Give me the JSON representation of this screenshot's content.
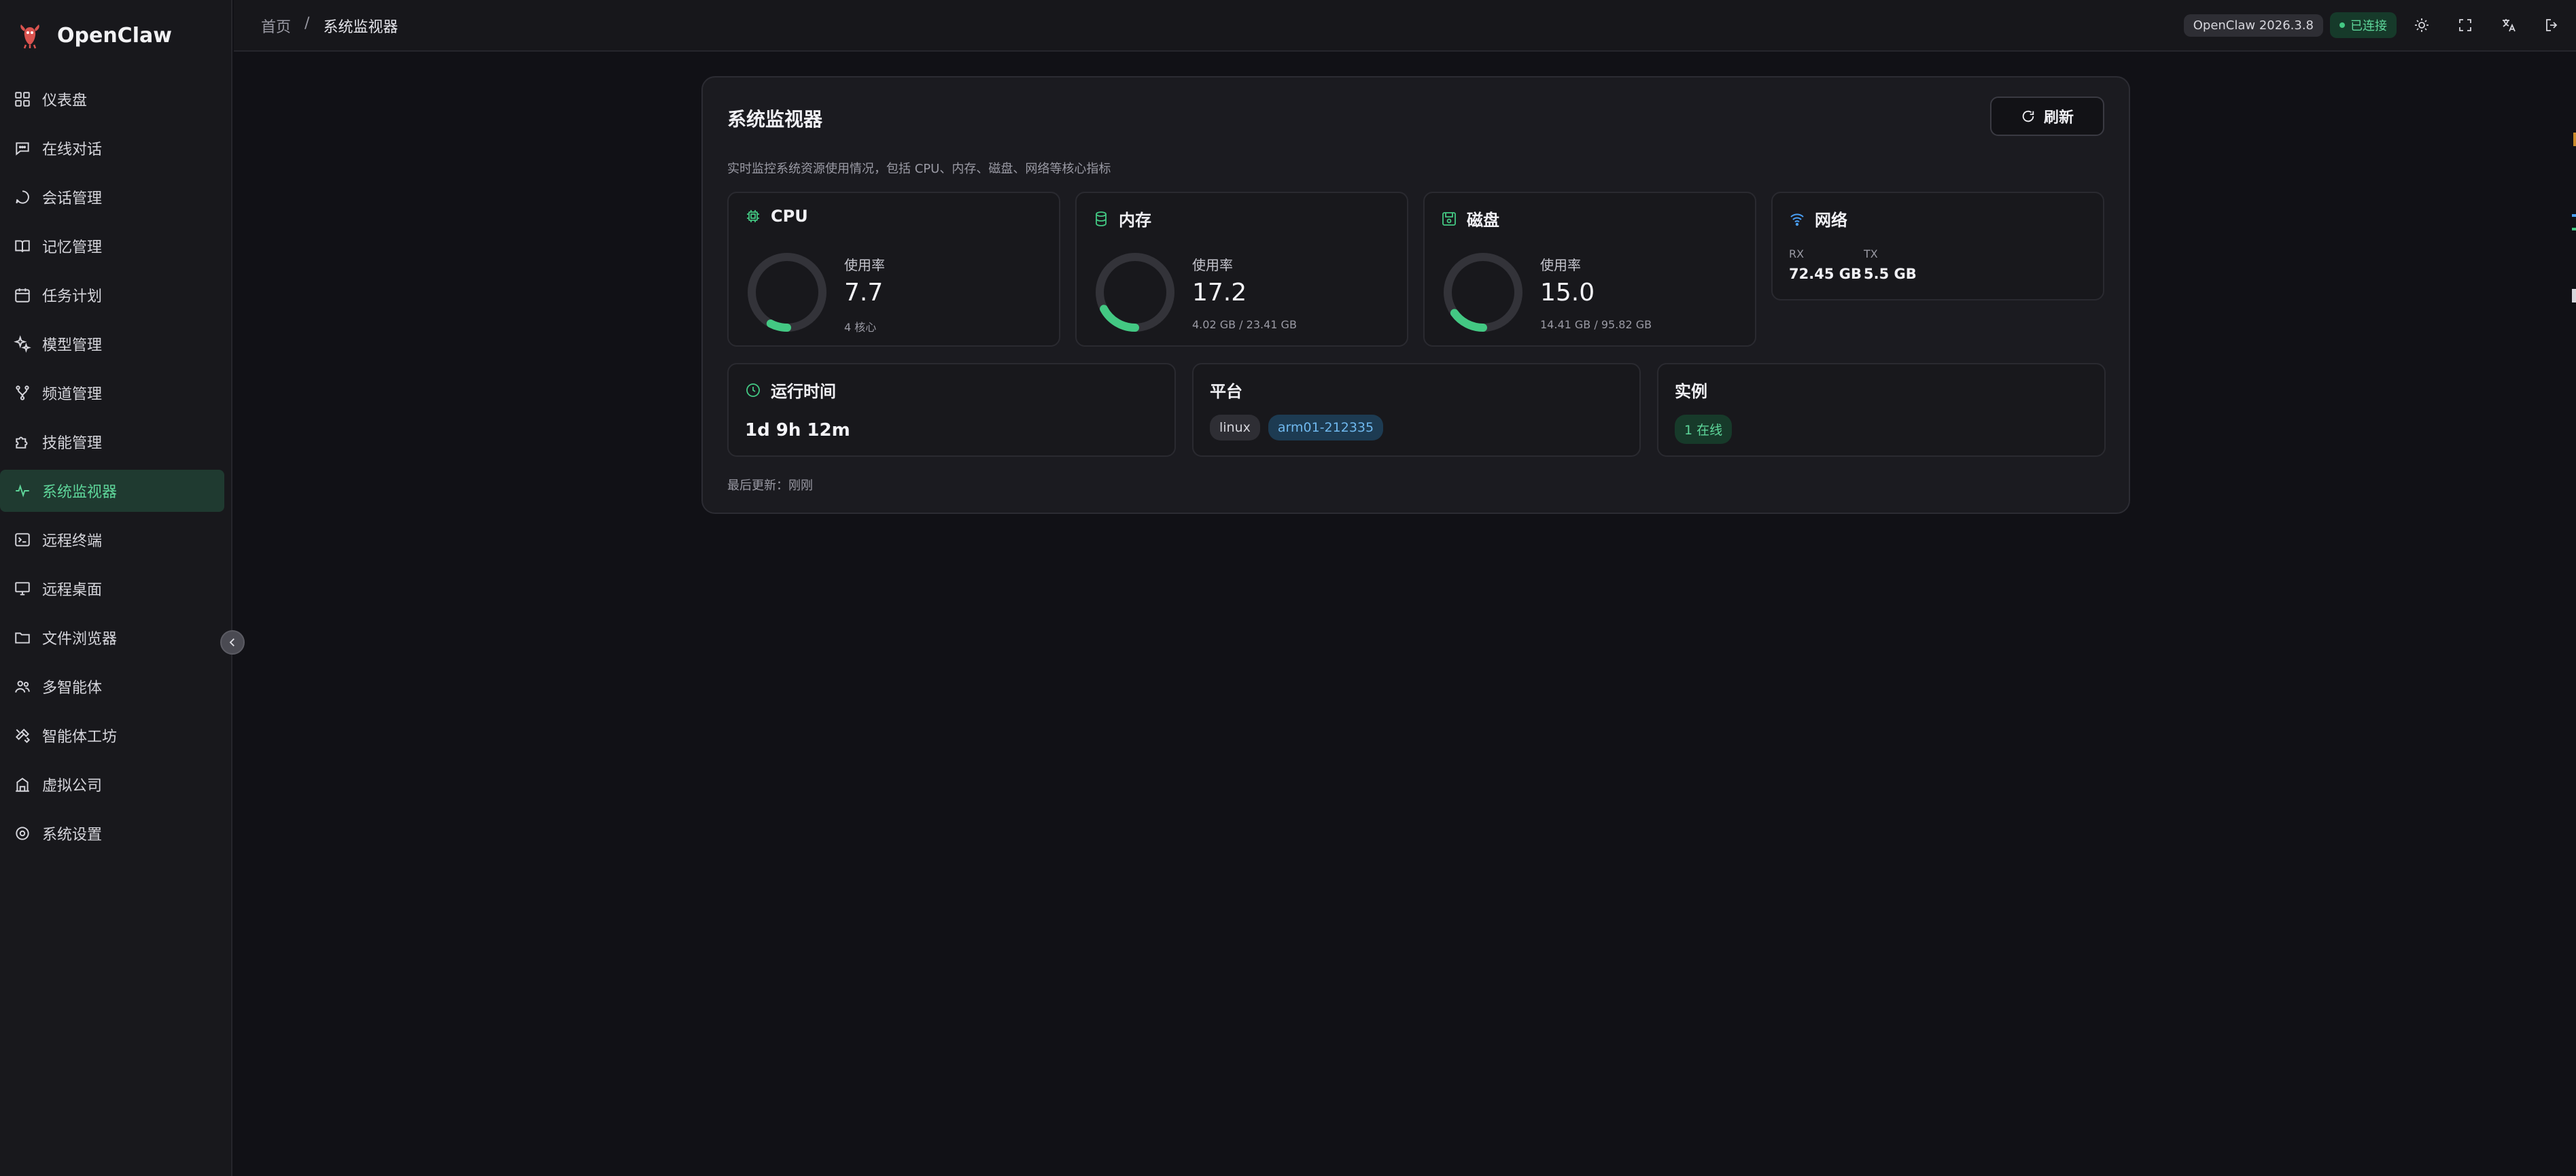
{
  "app": {
    "name": "OpenClaw"
  },
  "sidebar": {
    "items": [
      {
        "label": "仪表盘",
        "icon": "dashboard-icon"
      },
      {
        "label": "在线对话",
        "icon": "chat-icon"
      },
      {
        "label": "会话管理",
        "icon": "session-icon"
      },
      {
        "label": "记忆管理",
        "icon": "book-icon"
      },
      {
        "label": "任务计划",
        "icon": "calendar-icon"
      },
      {
        "label": "模型管理",
        "icon": "sparkle-icon"
      },
      {
        "label": "频道管理",
        "icon": "branch-icon"
      },
      {
        "label": "技能管理",
        "icon": "puzzle-icon"
      },
      {
        "label": "系统监视器",
        "icon": "activity-icon"
      },
      {
        "label": "远程终端",
        "icon": "terminal-icon"
      },
      {
        "label": "远程桌面",
        "icon": "monitor-icon"
      },
      {
        "label": "文件浏览器",
        "icon": "folder-icon"
      },
      {
        "label": "多智能体",
        "icon": "users-icon"
      },
      {
        "label": "智能体工坊",
        "icon": "tools-icon"
      },
      {
        "label": "虚拟公司",
        "icon": "building-icon"
      },
      {
        "label": "系统设置",
        "icon": "settings-icon"
      }
    ],
    "active": "系统监视器"
  },
  "topbar": {
    "breadcrumb": {
      "home": "首页",
      "separator": "/",
      "current": "系统监视器"
    },
    "version": "OpenClaw 2026.3.8",
    "status": "已连接"
  },
  "monitor": {
    "title": "系统监视器",
    "refresh_label": "刷新",
    "description": "实时监控系统资源使用情况，包括 CPU、内存、磁盘、网络等核心指标",
    "cpu": {
      "title": "CPU",
      "label": "使用率",
      "value": "7.7",
      "sub": "4 核心",
      "percent": 7.7
    },
    "memory": {
      "title": "内存",
      "label": "使用率",
      "value": "17.2",
      "sub": "4.02 GB / 23.41 GB",
      "percent": 17.2
    },
    "disk": {
      "title": "磁盘",
      "label": "使用率",
      "value": "15.0",
      "sub": "14.41 GB / 95.82 GB",
      "percent": 15.0
    },
    "network": {
      "title": "网络",
      "rx_label": "RX",
      "rx_value": "72.45 GB",
      "tx_label": "TX",
      "tx_value": "5.5 GB"
    },
    "uptime": {
      "title": "运行时间",
      "value": "1d 9h 12m"
    },
    "platform": {
      "title": "平台",
      "os": "linux",
      "host": "arm01-212335"
    },
    "instances": {
      "title": "实例",
      "value": "1 在线"
    },
    "last_update": "最后更新：刚刚"
  },
  "colors": {
    "accent": "#43c883",
    "active_bg": "#1f3a30",
    "network_icon": "#4a9ff5"
  }
}
